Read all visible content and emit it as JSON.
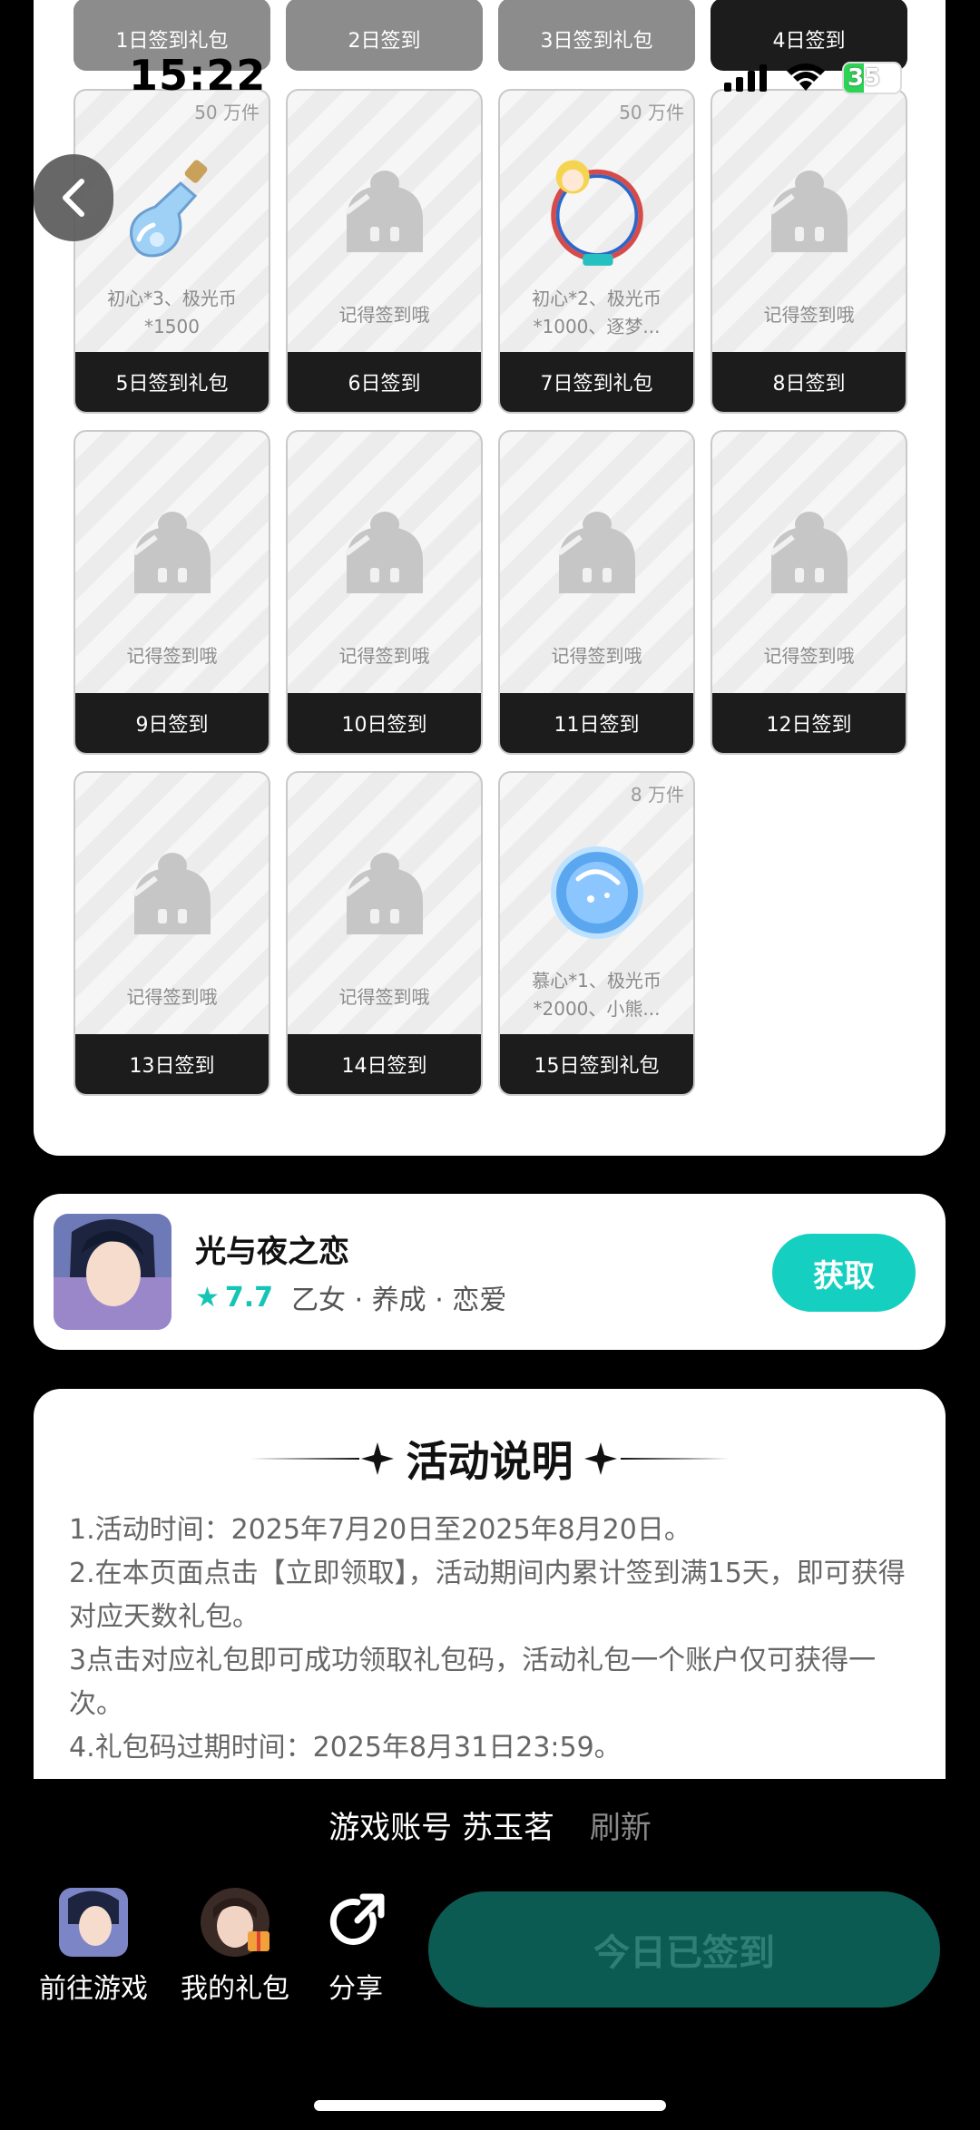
{
  "status_bar": {
    "time": "15:22",
    "battery": "35"
  },
  "top_row": [
    {
      "label": "1日签到礼包"
    },
    {
      "label": "2日签到"
    },
    {
      "label": "3日签到礼包"
    },
    {
      "label": "4日签到"
    }
  ],
  "cards": [
    {
      "label": "5日签到礼包",
      "badge": "50 万件",
      "desc": "初心*3、极光币*1500",
      "icon": "bottle-icon"
    },
    {
      "label": "6日签到",
      "badge": "",
      "desc": "记得签到哦",
      "icon": "placeholder-icon"
    },
    {
      "label": "7日签到礼包",
      "badge": "50 万件",
      "desc": "初心*2、极光币*1000、逐梦...",
      "icon": "ring-frame-icon"
    },
    {
      "label": "8日签到",
      "badge": "",
      "desc": "记得签到哦",
      "icon": "placeholder-icon"
    },
    {
      "label": "9日签到",
      "badge": "",
      "desc": "记得签到哦",
      "icon": "placeholder-icon"
    },
    {
      "label": "10日签到",
      "badge": "",
      "desc": "记得签到哦",
      "icon": "placeholder-icon"
    },
    {
      "label": "11日签到",
      "badge": "",
      "desc": "记得签到哦",
      "icon": "placeholder-icon"
    },
    {
      "label": "12日签到",
      "badge": "",
      "desc": "记得签到哦",
      "icon": "placeholder-icon"
    },
    {
      "label": "13日签到",
      "badge": "",
      "desc": "记得签到哦",
      "icon": "placeholder-icon"
    },
    {
      "label": "14日签到",
      "badge": "",
      "desc": "记得签到哦",
      "icon": "placeholder-icon"
    },
    {
      "label": "15日签到礼包",
      "badge": "8 万件",
      "desc": "慕心*1、极光币*2000、小熊...",
      "icon": "coin-icon"
    }
  ],
  "game": {
    "title": "光与夜之恋",
    "rating": "7.7",
    "tags": "乙女 · 养成 · 恋爱",
    "get_label": "获取"
  },
  "rules": {
    "title": "活动说明",
    "lines": [
      "1.活动时间：2025年7月20日至2025年8月20日。",
      "2.在本页面点击【立即领取】，活动期间内累计签到满15天，即可获得对应天数礼包。",
      "3点击对应礼包即可成功领取礼包码，活动礼包一个账户仅可获得一次。",
      "4.礼包码过期时间：2025年8月31日23:59。"
    ]
  },
  "account": {
    "prefix": "游戏账号",
    "name": "苏玉茗",
    "refresh": "刷新"
  },
  "nav": {
    "go_game": "前往游戏",
    "my_gifts": "我的礼包",
    "share": "分享"
  },
  "checkin_label": "今日已签到",
  "colors": {
    "accent": "#15d0c0",
    "checkin_bg": "#0c5b52",
    "card_label_bg": "#1c1c1c"
  }
}
